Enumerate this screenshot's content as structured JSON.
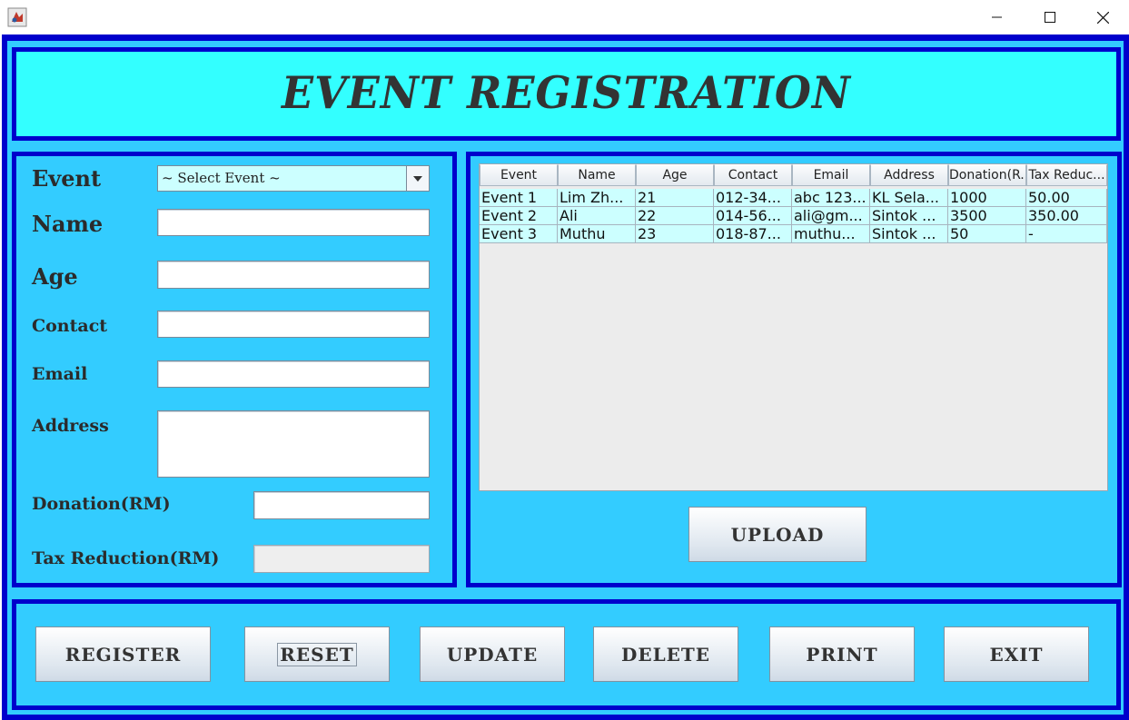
{
  "window": {
    "minimize_label": "Minimize",
    "maximize_label": "Maximize",
    "close_label": "Close"
  },
  "header": {
    "title": "EVENT REGISTRATION"
  },
  "form": {
    "event_label": "Event",
    "event_selected": "~ Select Event ~",
    "name_label": "Name",
    "age_label": "Age",
    "contact_label": "Contact",
    "email_label": "Email",
    "address_label": "Address",
    "donation_label": "Donation(RM)",
    "tax_label": "Tax Reduction(RM)"
  },
  "table": {
    "columns": [
      "Event",
      "Name",
      "Age",
      "Contact",
      "Email",
      "Address",
      "Donation(R...",
      "Tax Reduc..."
    ],
    "rows": [
      [
        "Event 1",
        "Lim Zh...",
        "21",
        "012-34...",
        "abc 123...",
        "KL Sela...",
        "1000",
        "50.00"
      ],
      [
        "Event 2",
        "Ali",
        "22",
        "014-56...",
        "ali@gm...",
        "Sintok ...",
        "3500",
        "350.00"
      ],
      [
        "Event 3",
        "Muthu",
        "23",
        "018-87...",
        "muthu...",
        "Sintok ...",
        "50",
        "-"
      ]
    ]
  },
  "buttons": {
    "upload": "UPLOAD",
    "register": "REGISTER",
    "reset": "RESET",
    "update": "UPDATE",
    "delete": "DELETE",
    "print": "PRINT",
    "exit": "EXIT"
  },
  "colors": {
    "background": "#33ccff",
    "border": "#0000cc",
    "header_bg": "#33ffff",
    "table_row_bg": "#ccffff"
  }
}
